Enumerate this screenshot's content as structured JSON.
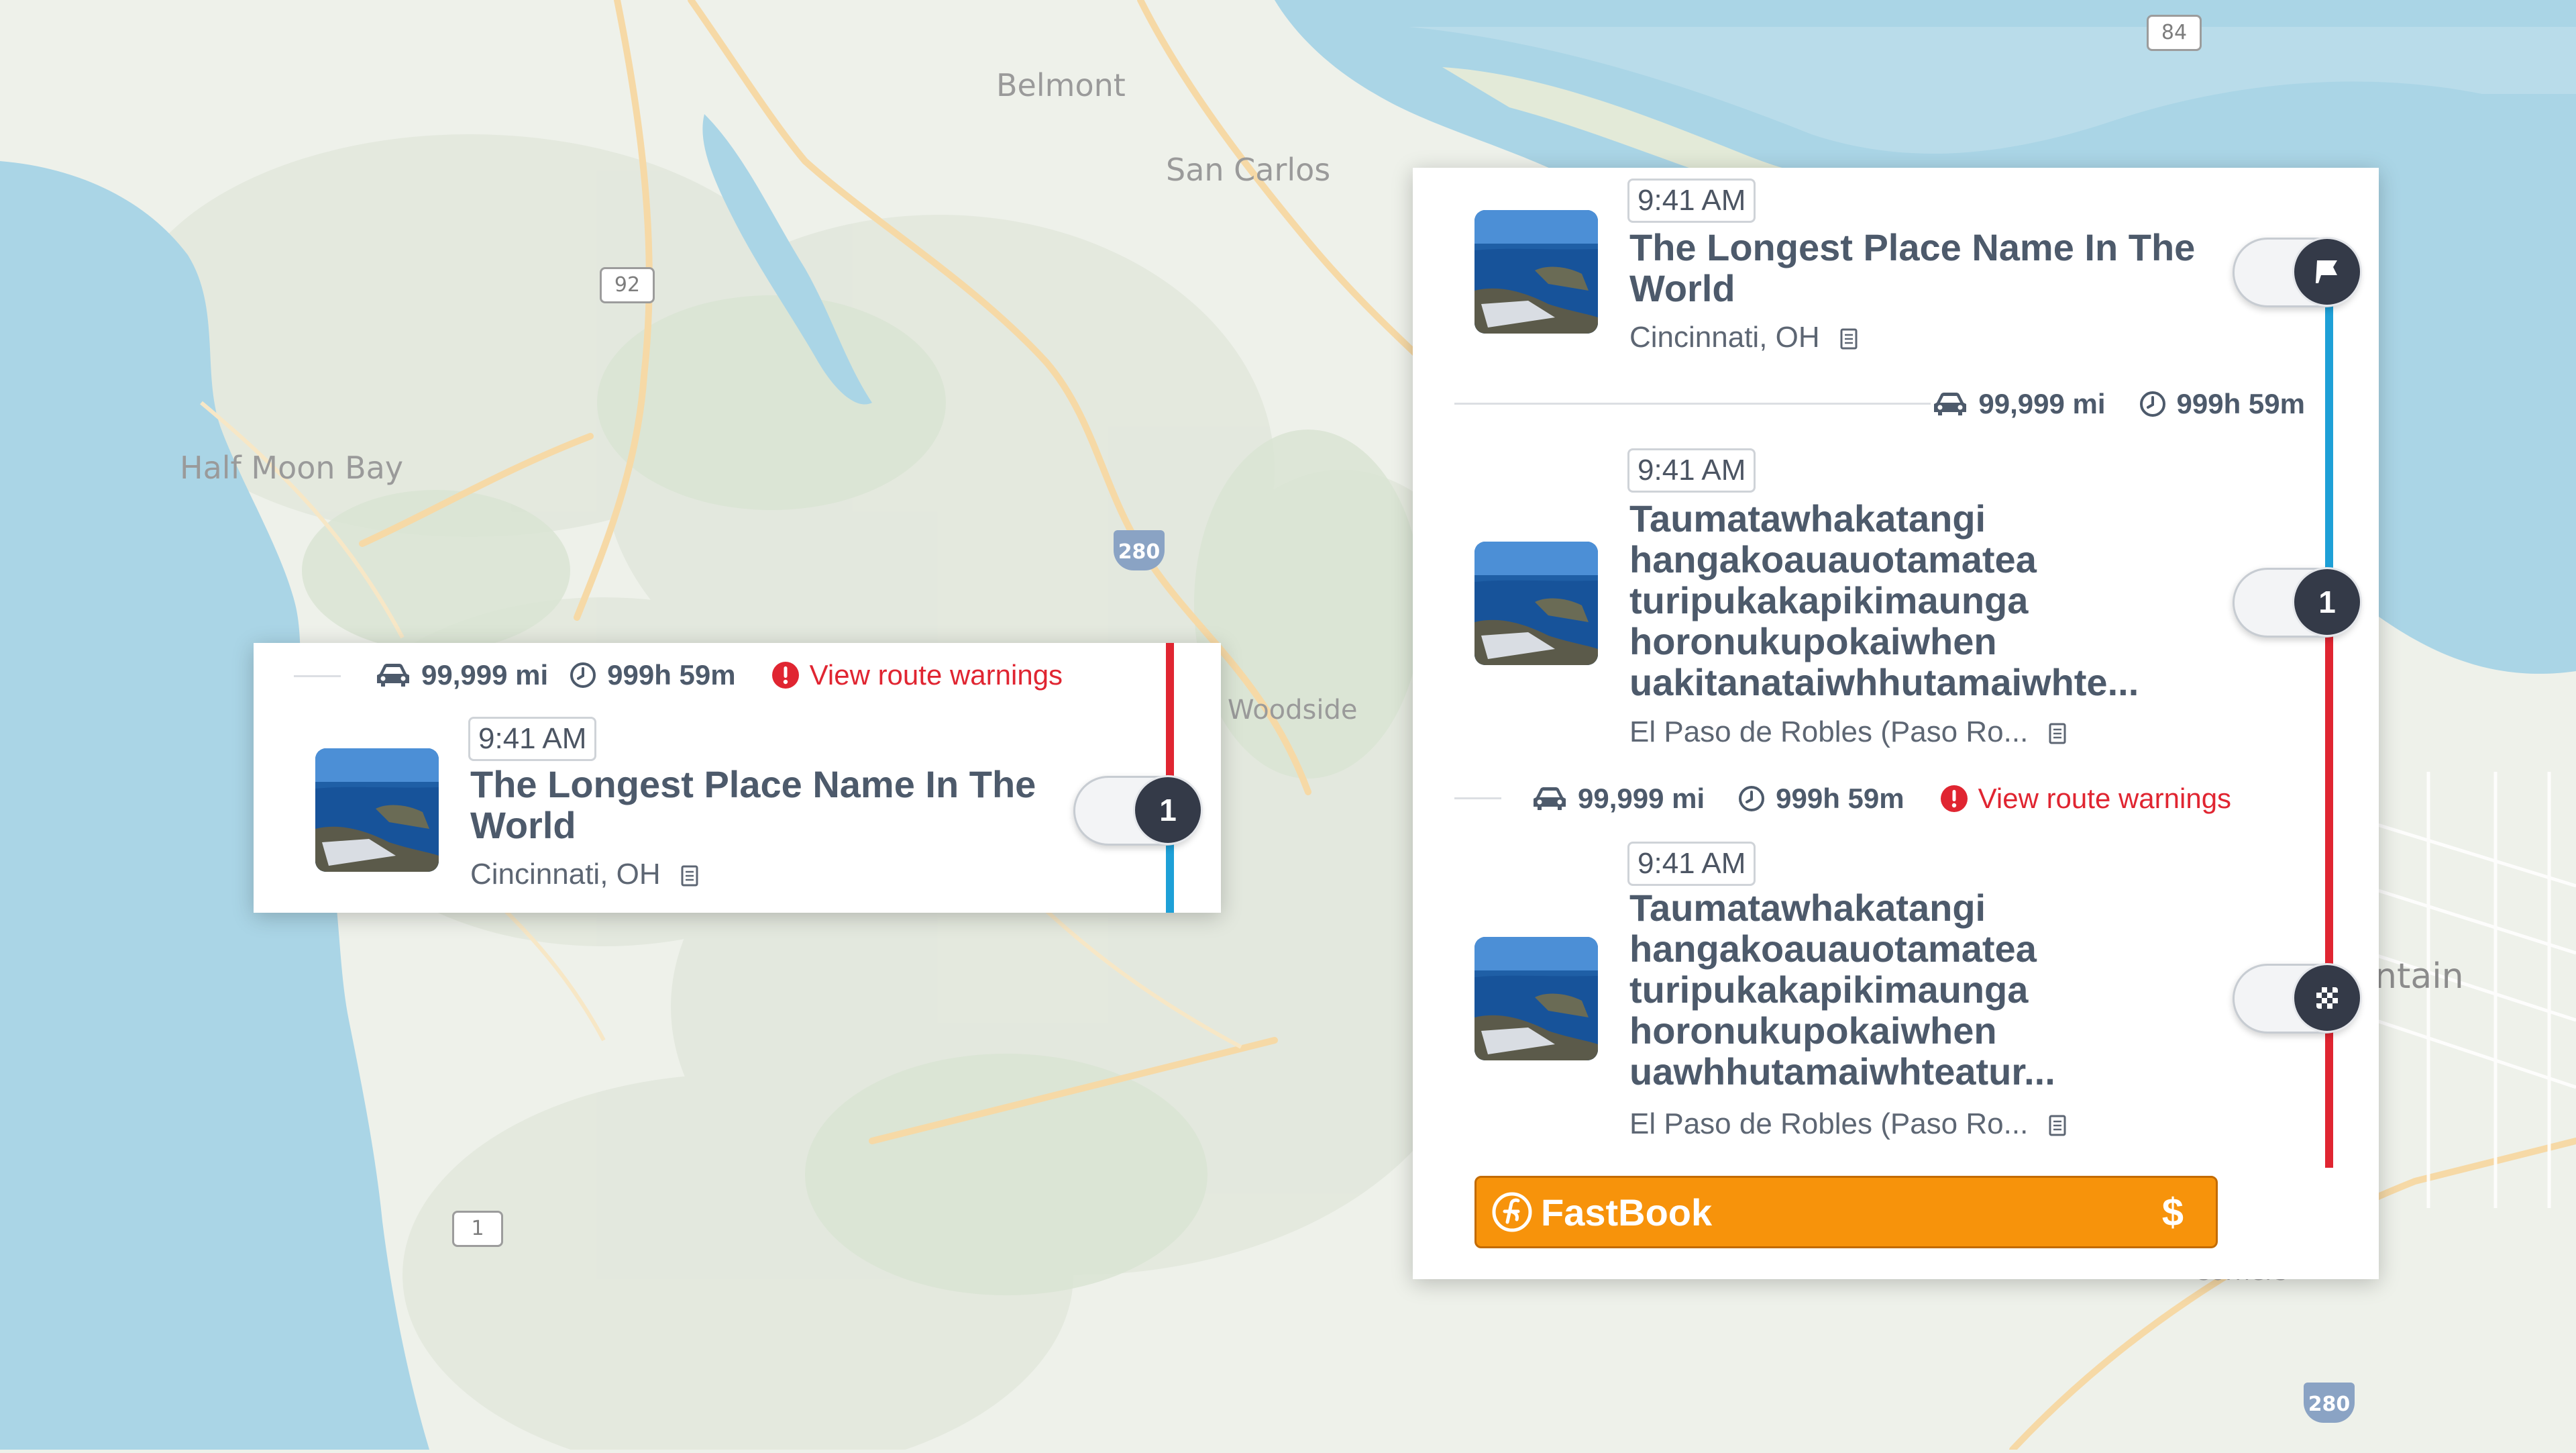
{
  "map": {
    "places": [
      "Belmont",
      "San Carlos",
      "Half Moon Bay",
      "Woodside",
      "ntain",
      "Corners"
    ],
    "shields": [
      "84",
      "92",
      "280",
      "1",
      "280"
    ],
    "colors": {
      "water": "#aad5e6",
      "land": "#eef1ea",
      "roads": "#f7d7a4"
    }
  },
  "left_card": {
    "stats": {
      "distance": "99,999 mi",
      "duration": "999h 59m",
      "warning": "View route warnings"
    },
    "stop": {
      "time": "9:41 AM",
      "name": "The Longest Place Name In The World",
      "city": "Cincinnati, OH",
      "badge": "1"
    },
    "line_colors": {
      "above": "#e02531",
      "below": "#1ea0d7"
    }
  },
  "right_card": {
    "stops": [
      {
        "time": "9:41 AM",
        "name": "The Longest Place Name In The World",
        "city": "Cincinnati, OH",
        "icon": "flag-icon"
      },
      {
        "time": "9:41 AM",
        "name_lines": [
          "Taumatawhakatangi",
          "hangakoauauotamatea",
          "turipukakapikimaunga",
          "horonukupokaiwhen",
          "uakitanataiwhhutamaiwhte..."
        ],
        "city": "El Paso de Robles (Paso Ro...",
        "badge": "1"
      },
      {
        "time": "9:41 AM",
        "name_lines": [
          "Taumatawhakatangi",
          "hangakoauauotamatea",
          "turipukakapikimaunga",
          "horonukupokaiwhen",
          "uawhhutamaiwhteatur..."
        ],
        "city": "El Paso de Robles (Paso Ro...",
        "icon": "checkered-flag-icon"
      }
    ],
    "leg1": {
      "distance": "99,999 mi",
      "duration": "999h 59m"
    },
    "leg2": {
      "distance": "99,999 mi",
      "duration": "999h 59m",
      "warning": "View route warnings"
    },
    "fastbook": {
      "label": "FastBook",
      "price_symbol": "$",
      "color": "#f7930b"
    },
    "line_colors": {
      "leg1": "#1ea0d7",
      "leg2": "#e02531"
    }
  }
}
